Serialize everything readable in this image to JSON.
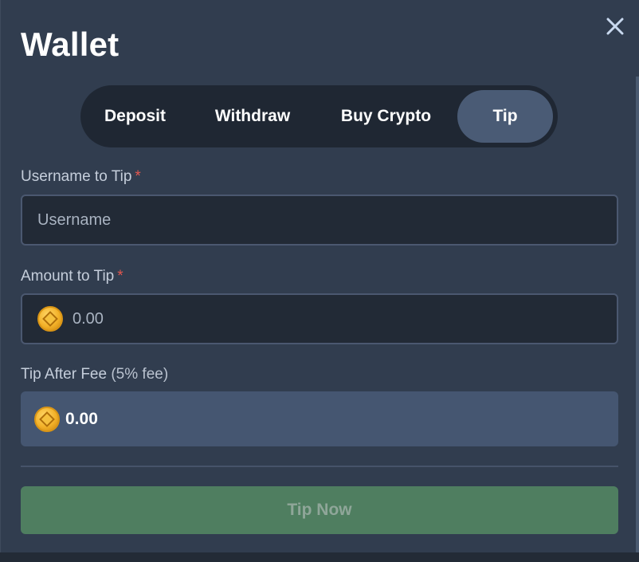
{
  "modal": {
    "title": "Wallet"
  },
  "tabs": [
    {
      "label": "Deposit",
      "active": false
    },
    {
      "label": "Withdraw",
      "active": false
    },
    {
      "label": "Buy Crypto",
      "active": false
    },
    {
      "label": "Tip",
      "active": true
    }
  ],
  "username_field": {
    "label": "Username to Tip",
    "required_mark": "*",
    "placeholder": "Username",
    "value": ""
  },
  "amount_field": {
    "label": "Amount to Tip",
    "required_mark": "*",
    "placeholder": "0.00",
    "value": "",
    "icon": "coin-icon"
  },
  "fee": {
    "label": "Tip After Fee",
    "note": "(5% fee)",
    "value": "0.00",
    "icon": "coin-icon"
  },
  "submit": {
    "label": "Tip Now",
    "disabled": true
  },
  "colors": {
    "panel": "#313d4f",
    "active_tab": "#4a5b75",
    "required": "#e3574f",
    "button": "#4f7e60",
    "fee_box": "#455671"
  }
}
